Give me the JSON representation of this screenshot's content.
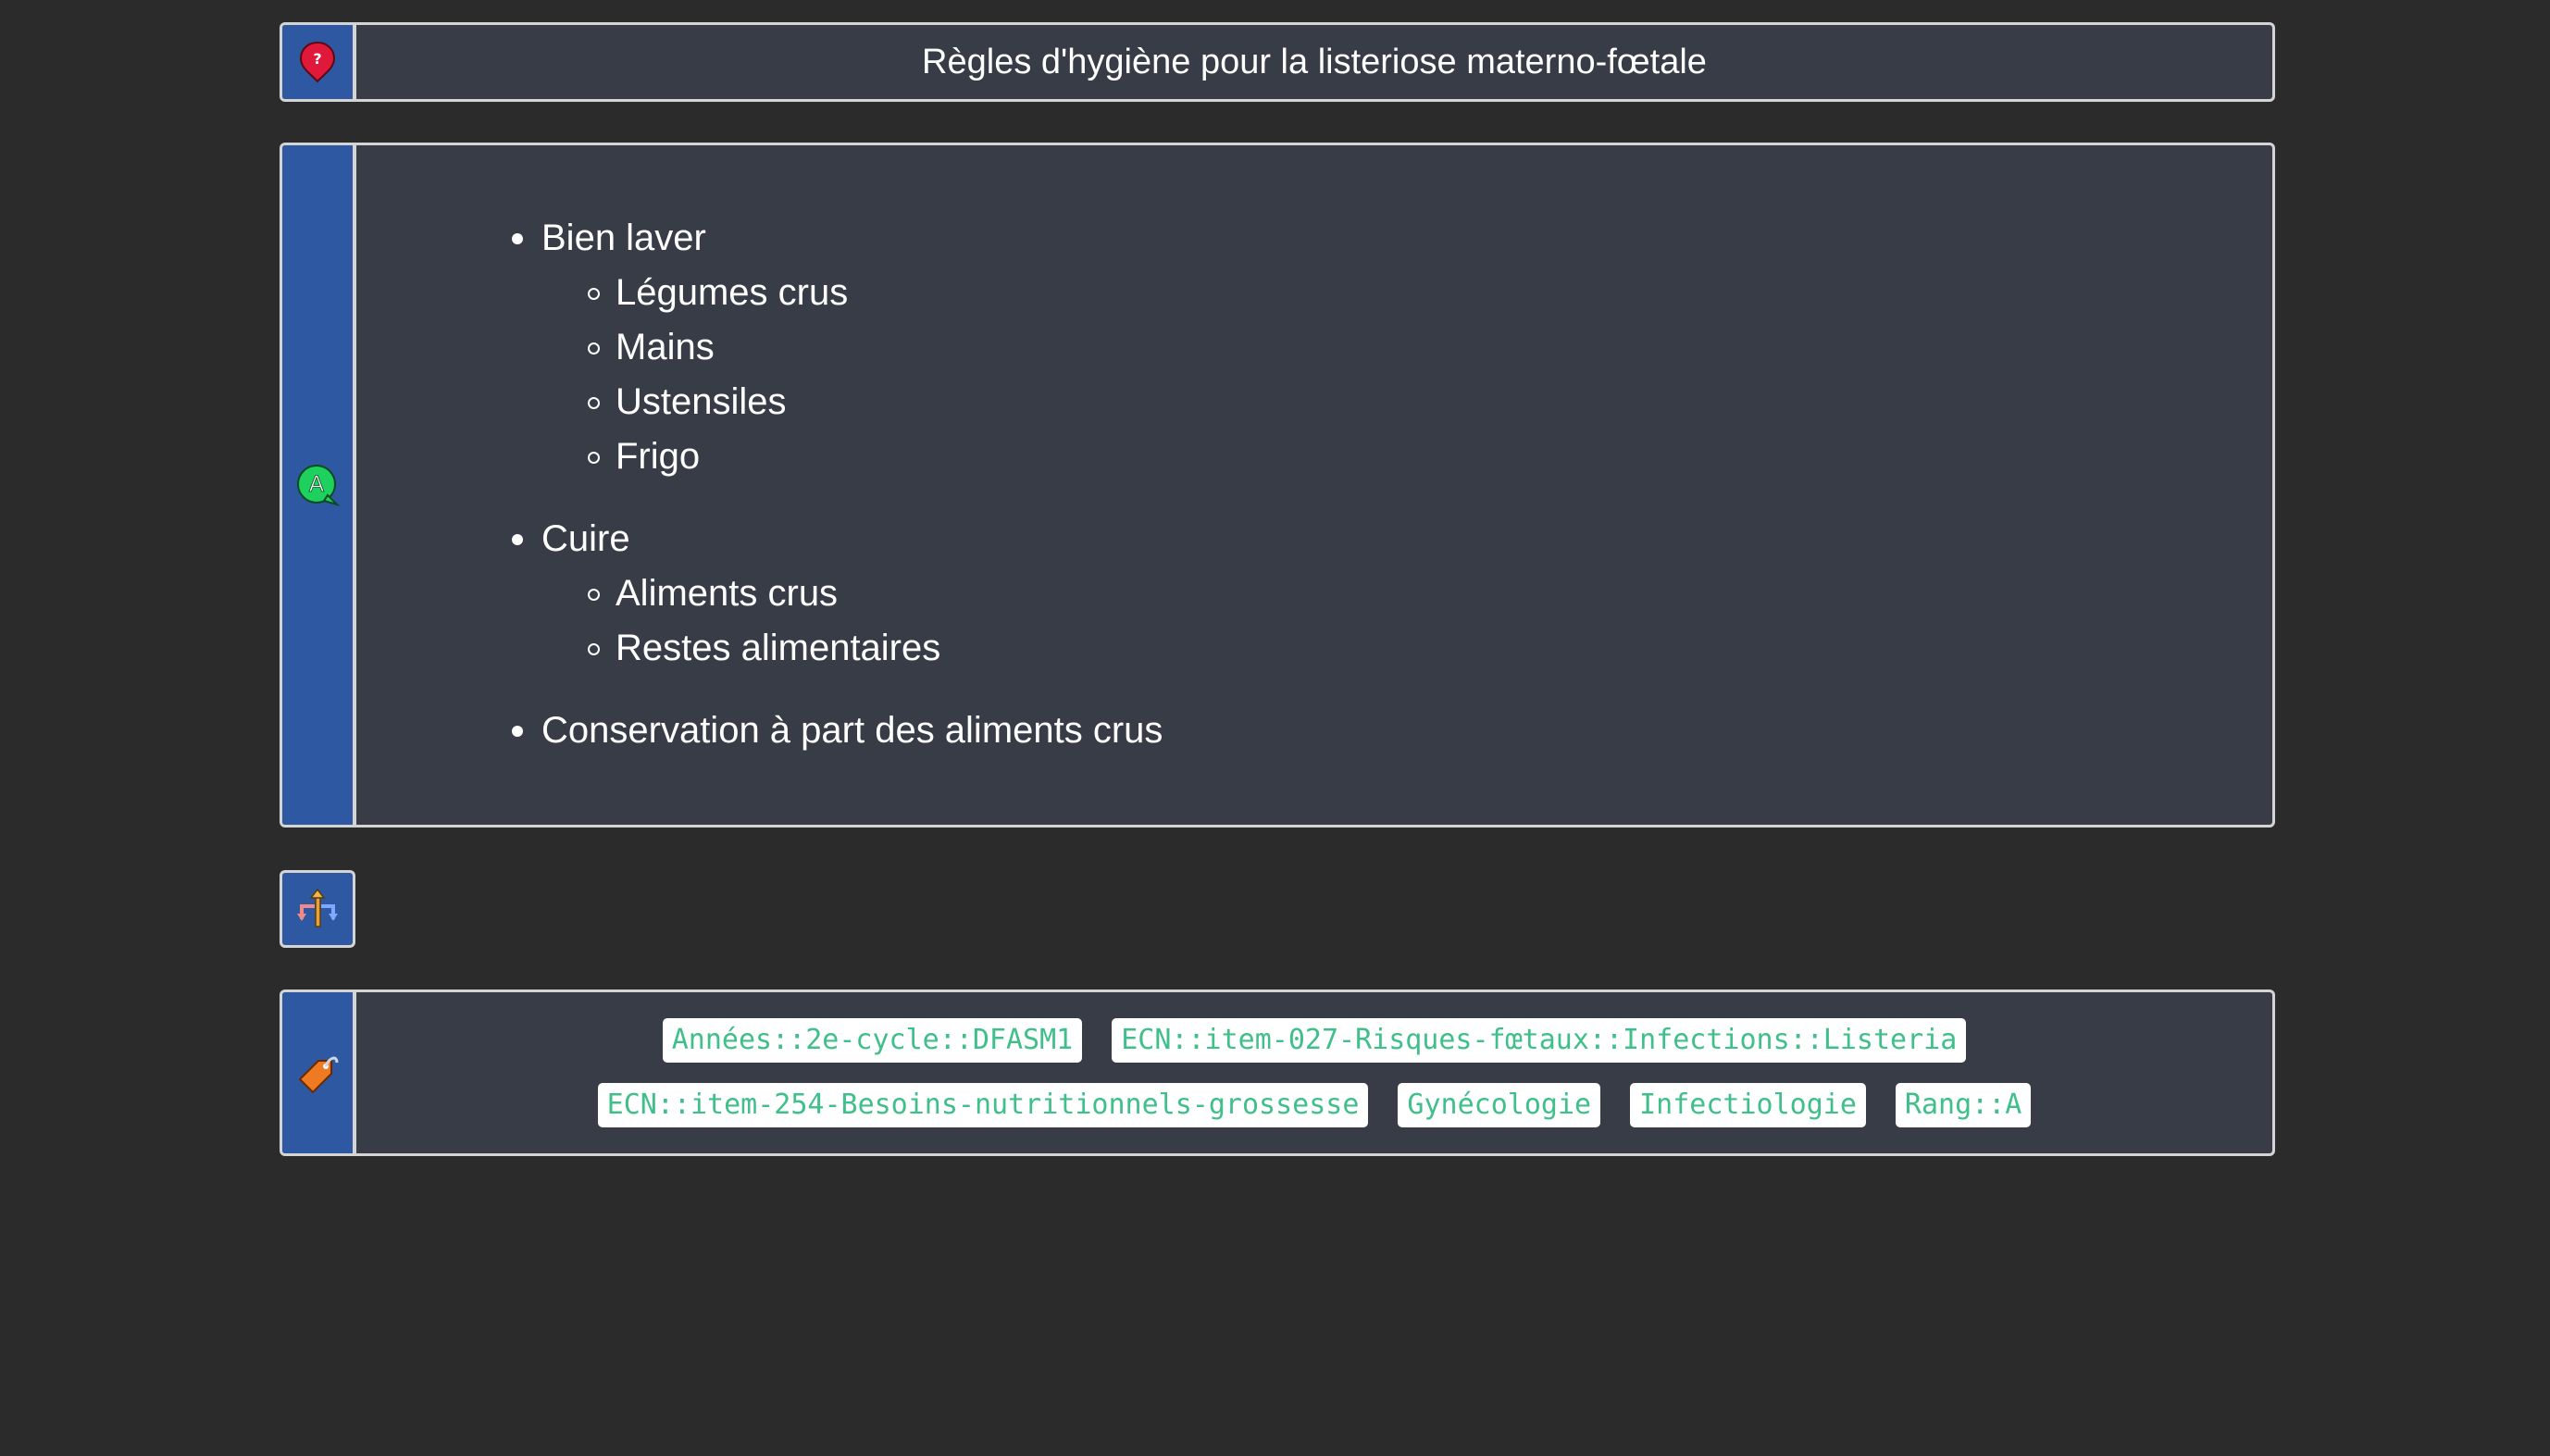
{
  "question": {
    "title": "Règles d'hygiène pour la listeriose materno-fœtale",
    "icon": "question-pin-icon"
  },
  "answer": {
    "icon": "answer-bubble-icon",
    "items": [
      {
        "label": "Bien laver",
        "children": [
          "Légumes crus",
          "Mains",
          "Ustensiles",
          "Frigo"
        ]
      },
      {
        "label": "Cuire",
        "children": [
          "Aliments crus",
          "Restes alimentaires"
        ]
      },
      {
        "label": "Conservation à part des aliments crus",
        "children": []
      }
    ]
  },
  "extra": {
    "icon": "signpost-icon"
  },
  "tags": {
    "icon": "tag-icon",
    "rows": [
      [
        "Années::2e-cycle::DFASM1",
        "ECN::item-027-Risques-fœtaux::Infections::Listeria"
      ],
      [
        "ECN::item-254-Besoins-nutritionnels-grossesse",
        "Gynécologie",
        "Infectiologie",
        "Rang::A"
      ]
    ]
  },
  "colors": {
    "background": "#2b2b2b",
    "card": "#383c47",
    "sidebar": "#2e58a1",
    "border": "#d4d4d4",
    "tag_text": "#3fbf8a"
  }
}
